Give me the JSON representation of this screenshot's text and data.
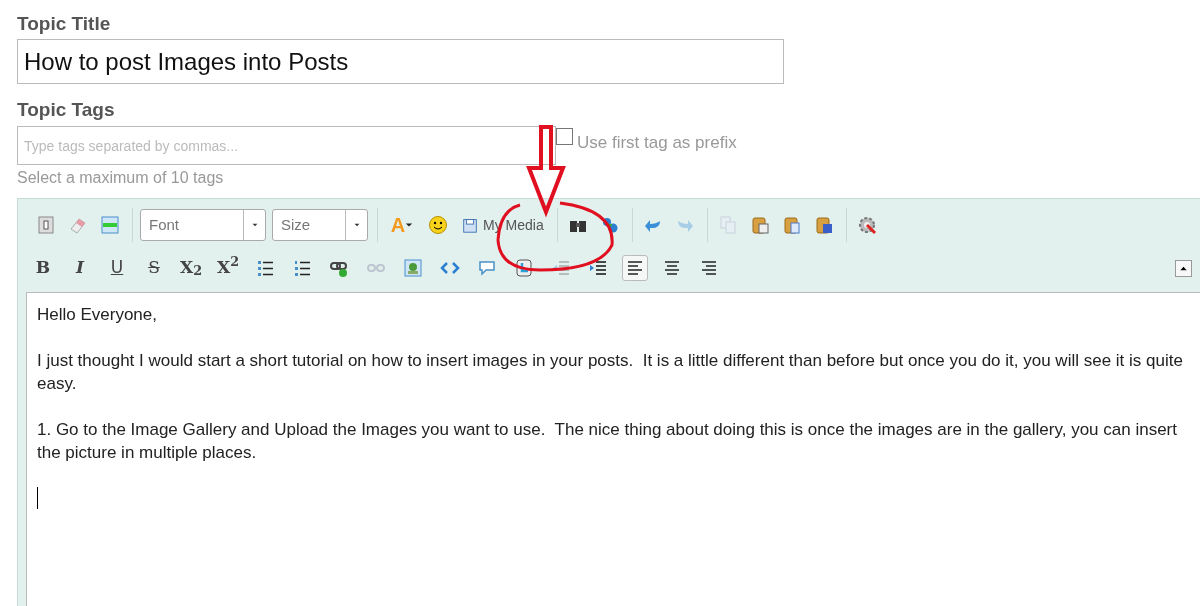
{
  "title_field": {
    "label": "Topic Title",
    "value": "How to post Images into Posts"
  },
  "tags_field": {
    "label": "Topic Tags",
    "placeholder": "Type tags separated by commas...",
    "prefix_option": {
      "label": "Use first tag as prefix",
      "checked": false
    },
    "hint": "Select a maximum of 10 tags"
  },
  "toolbar": {
    "row_1": [
      [
        {
          "kind": "icon",
          "disabled": false
        },
        {
          "kind": "icon",
          "disabled": false
        },
        {
          "kind": "icon",
          "disabled": false
        }
      ],
      [
        {
          "kind": "select",
          "placeholder": "Font"
        },
        {
          "kind": "select",
          "placeholder": "Size"
        }
      ],
      [
        {
          "kind": "font-color",
          "label": "A"
        },
        {
          "kind": "icon",
          "disabled": false
        },
        {
          "kind": "media",
          "label": "My Media"
        }
      ],
      [
        {
          "kind": "icon",
          "disabled": false
        },
        {
          "kind": "icon",
          "disabled": false
        }
      ],
      [
        {
          "kind": "icon",
          "disabled": false
        },
        {
          "kind": "icon",
          "disabled": true
        }
      ],
      [
        {
          "kind": "icon",
          "disabled": true
        },
        {
          "kind": "icon",
          "disabled": false
        },
        {
          "kind": "icon",
          "disabled": false
        },
        {
          "kind": "icon",
          "disabled": false
        }
      ],
      [
        {
          "kind": "icon",
          "disabled": false
        }
      ]
    ],
    "row_2": [
      {
        "kind": "bold",
        "label": "B"
      },
      {
        "kind": "italic",
        "label": "I"
      },
      {
        "kind": "underline",
        "label": "U"
      },
      {
        "kind": "strike",
        "label": "S"
      },
      {
        "kind": "sub",
        "label": "X$_{2}$"
      },
      {
        "kind": "sup",
        "label": "X$^{2}$"
      },
      {
        "kind": "icon",
        "disabled": false
      },
      {
        "kind": "icon",
        "disabled": false
      },
      {
        "kind": "icon",
        "disabled": false
      },
      {
        "kind": "icon",
        "disabled": true
      },
      {
        "kind": "icon",
        "disabled": false
      },
      {
        "kind": "icon",
        "disabled": false
      },
      {
        "kind": "icon",
        "disabled": false
      },
      {
        "kind": "icon",
        "disabled": false
      },
      {
        "kind": "icon",
        "disabled": true
      },
      {
        "kind": "icon",
        "disabled": false
      },
      {
        "kind": "align",
        "selected": true
      },
      {
        "kind": "align",
        "selected": false
      },
      {
        "kind": "align",
        "selected": false
      }
    ]
  },
  "editor": {
    "paragraphs": [
      "Hello Everyone,",
      "I just thought I would start a short tutorial on how to insert images in your posts.  It is a little different than before but once you do it, you will see it is quite easy.",
      "1. Go to the Image Gallery and Upload the Images you want to use.  The nice thing about doing this is once the images are in the gallery, you can insert the picture in multiple places."
    ]
  }
}
